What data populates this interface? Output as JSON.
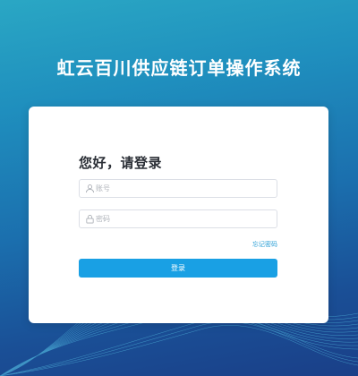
{
  "header": {
    "system_title": "虹云百川供应链订单操作系统"
  },
  "login": {
    "greeting": "您好，请登录",
    "username": {
      "value": "",
      "placeholder": "账号",
      "icon": "user-icon"
    },
    "password": {
      "value": "",
      "placeholder": "密码",
      "icon": "lock-icon"
    },
    "forgot_password_label": "忘记密码",
    "submit_label": "登录"
  },
  "colors": {
    "background_top": "#2aa7c4",
    "background_bottom": "#1a3f88",
    "primary_button": "#19a0e4",
    "link": "#2a9fd6",
    "title_text": "#ffffff"
  }
}
